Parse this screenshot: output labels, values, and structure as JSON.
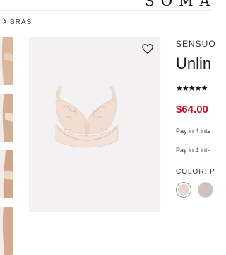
{
  "header": {
    "brand": "SOMA"
  },
  "breadcrumb": {
    "current": "BRAS"
  },
  "product": {
    "brand_line": "SENSUO",
    "title": "Unlin",
    "rating_stars": "★★★★★",
    "price": "$64.00",
    "pay_line_1": "Pay in 4 inte",
    "pay_line_2": "Pay in 4 inte",
    "color_label": "COLOR: P",
    "swatches": [
      "blush-pink",
      "taupe"
    ]
  },
  "colors": {
    "accent_price": "#c2122f",
    "image_bg": "#f3f1f1",
    "bra_fabric": "#f1ddd2",
    "embroidery": "#d6c3b6"
  },
  "icons": [
    "chevron-right-icon",
    "heart-icon"
  ]
}
